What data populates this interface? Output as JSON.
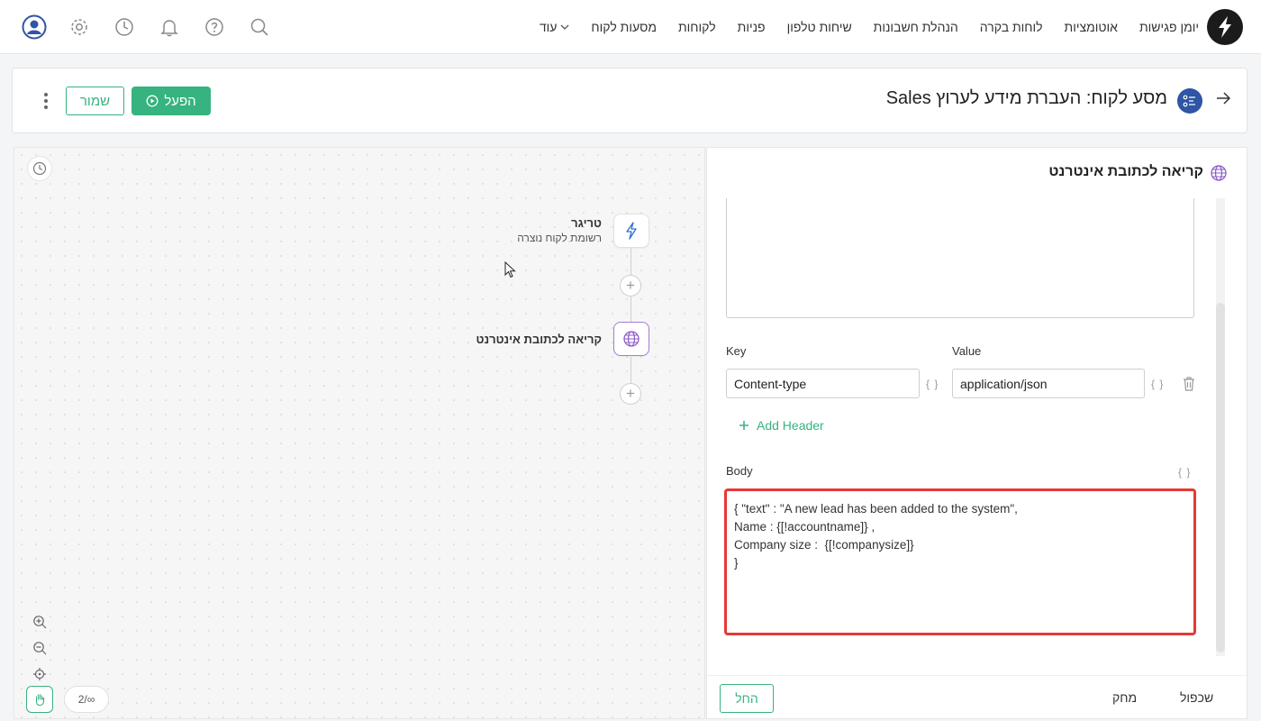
{
  "nav": {
    "items": [
      "יומן פגישות",
      "אוטומציות",
      "לוחות בקרה",
      "הנהלת חשבונות",
      "שיחות טלפון",
      "פניות",
      "לקוחות",
      "מסעות לקוח"
    ],
    "more_label": "עוד"
  },
  "header": {
    "title": "מסע לקוח: העברת מידע לערוץ Sales",
    "activate_label": "הפעל",
    "save_label": "שמור"
  },
  "canvas": {
    "trigger_title": "טריגר",
    "trigger_subtitle": "רשומת לקוח נוצרה",
    "web_call_title": "קריאה לכתובת אינטרנט",
    "page_indicator": "2/∞"
  },
  "panel": {
    "title": "קריאה לכתובת אינטרנט",
    "key_label": "Key",
    "value_label": "Value",
    "key_value": "Content-type",
    "value_value": "application/json",
    "brace_symbol": "{ }",
    "add_header_label": "Add Header",
    "body_label": "Body",
    "body_text": "{ \"text\" : \"A new lead has been added to the system\",\nName : {[!accountname]} ,\nCompany size :  {[!companysize]}\n}",
    "footer": {
      "cancel_label": "החל",
      "delete_label": "מחק",
      "duplicate_label": "שכפול"
    }
  },
  "colors": {
    "accent_green": "#36b37e",
    "highlight_red": "#e53935",
    "node_purple": "#a77bd8",
    "journey_blue": "#2f55a4"
  }
}
